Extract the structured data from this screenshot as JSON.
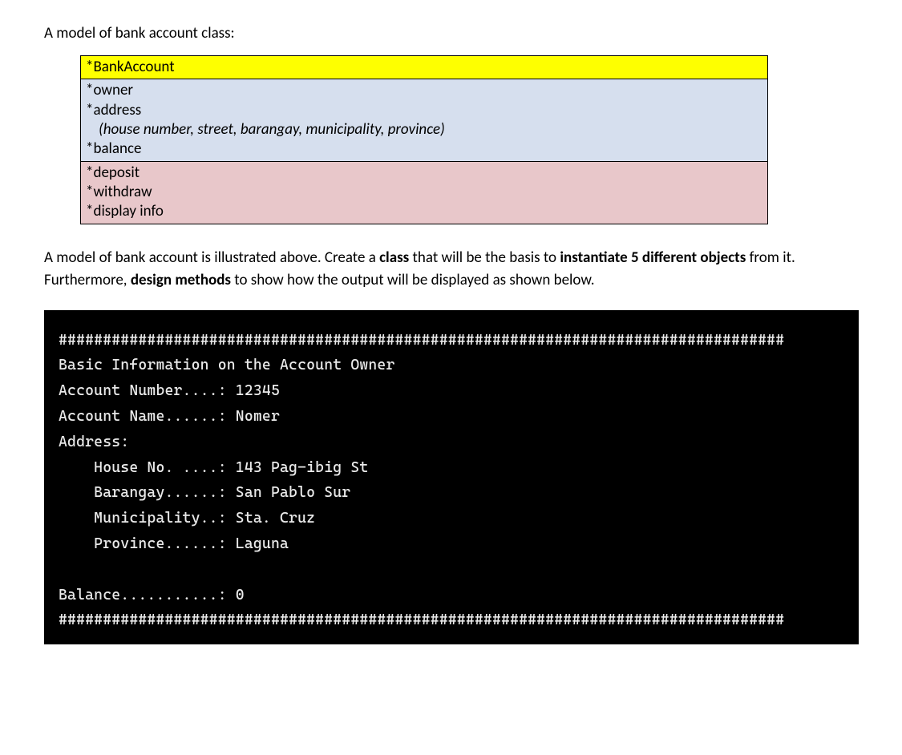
{
  "intro": "A model of bank account class:",
  "uml": {
    "classname": "*BankAccount",
    "attrs_line1": "*owner",
    "attrs_line2": "*address",
    "attrs_line3_sub": "(house number, street, barangay, municipality, province)",
    "attrs_line4": "*balance",
    "methods_line1": "*deposit",
    "methods_line2": "*withdraw",
    "methods_line3": "*display info"
  },
  "para": {
    "p1": "A model of bank account is illustrated above. Create a ",
    "b1": "class",
    "p2": " that will be the basis to ",
    "b2": "instantiate 5 different objects",
    "p3": " from it. Furthermore, ",
    "b3": "design methods",
    "p4": " to show how the output will be displayed as shown below."
  },
  "console": {
    "border": "##################################################################################",
    "title": "Basic Information on the Account Owner",
    "acct_num_label": "Account Number....: ",
    "acct_num_value": "12345",
    "acct_name_label": "Account Name......: ",
    "acct_name_value": "Nomer",
    "address_label": "Address:",
    "house_label": "    House No. ....: ",
    "house_value": "143 Pag-ibig St",
    "brgy_label": "    Barangay......: ",
    "brgy_value": "San Pablo Sur",
    "muni_label": "    Municipality..: ",
    "muni_value": "Sta. Cruz",
    "prov_label": "    Province......: ",
    "prov_value": "Laguna",
    "balance_label": "Balance...........: ",
    "balance_value": "0"
  }
}
